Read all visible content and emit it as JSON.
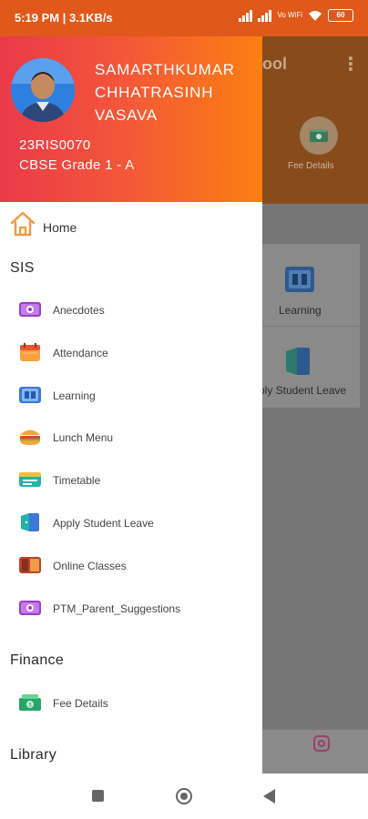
{
  "status_bar": {
    "time": "5:19 PM",
    "speed": "3.1KB/s",
    "network": "Vo WiFi",
    "battery": "60"
  },
  "background_app": {
    "title_fragment": "ool",
    "fee_details_label": "Fee Details",
    "learning_label": "Learning",
    "apply_leave_label": "ply Student Leave"
  },
  "drawer": {
    "student": {
      "name": "SAMARTHKUMAR CHHATRASINH VASAVA",
      "id": "23RIS0070",
      "grade": "CBSE Grade 1 - A"
    },
    "home_label": "Home",
    "sections": [
      {
        "title": "SIS",
        "items": [
          {
            "label": "Anecdotes",
            "icon": "camera-icon"
          },
          {
            "label": "Attendance",
            "icon": "calendar-icon"
          },
          {
            "label": "Learning",
            "icon": "book-icon"
          },
          {
            "label": "Lunch Menu",
            "icon": "burger-icon"
          },
          {
            "label": "Timetable",
            "icon": "timetable-icon"
          },
          {
            "label": "Apply Student Leave",
            "icon": "door-icon"
          },
          {
            "label": "Online Classes",
            "icon": "classes-icon"
          },
          {
            "label": "PTM_Parent_Suggestions",
            "icon": "camera-icon"
          }
        ]
      },
      {
        "title": "Finance",
        "items": [
          {
            "label": "Fee Details",
            "icon": "money-icon"
          }
        ]
      },
      {
        "title": "Library",
        "items": []
      }
    ]
  },
  "colors": {
    "header_gradient_start": "#ea3a49",
    "header_gradient_end": "#fb7f12",
    "status_bar": "#e1581b",
    "scrim_appbar": "#874b1c"
  }
}
